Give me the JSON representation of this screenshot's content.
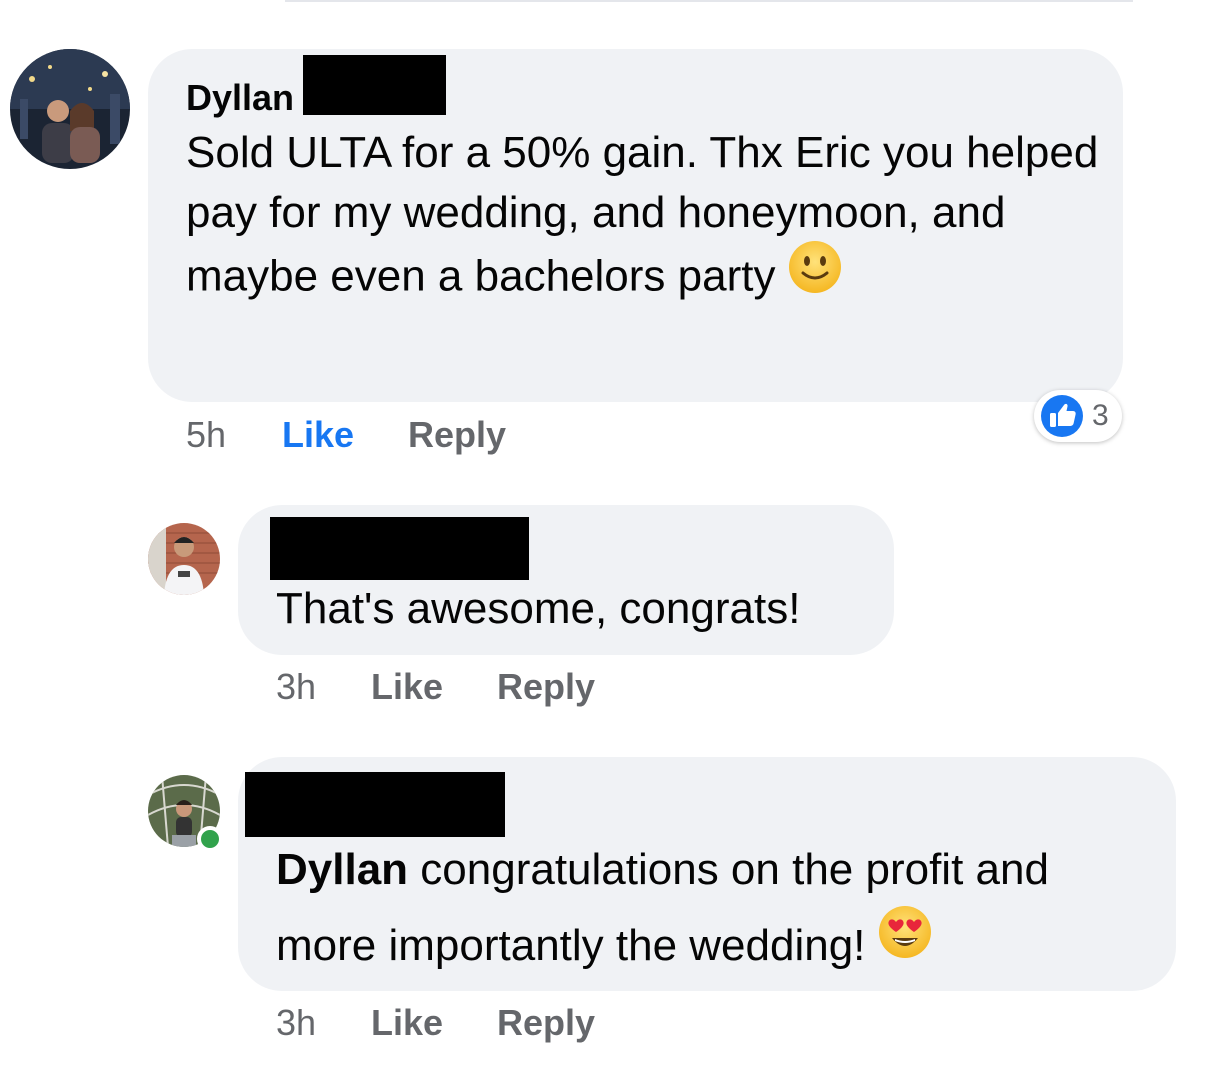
{
  "comments": [
    {
      "author": "Dyllan",
      "text": "Sold ULTA for a 50% gain. Thx Eric you helped pay for my wedding, and honeymoon, and maybe even a bachelors party",
      "emoji_icon": "slightly-smiling-face-icon",
      "time": "5h",
      "like_label": "Like",
      "reply_label": "Reply",
      "liked": true,
      "reaction": {
        "icon": "thumbs-up-icon",
        "count": "3",
        "color": "#1877f2"
      }
    },
    {
      "author": "",
      "text": "That's awesome, congrats!",
      "time": "3h",
      "like_label": "Like",
      "reply_label": "Reply",
      "liked": false
    },
    {
      "author": "",
      "mention": "Dyllan",
      "text": "congratulations on the profit and more importantly the wedding!",
      "emoji_icon": "heart-eyes-face-icon",
      "time": "3h",
      "like_label": "Like",
      "reply_label": "Reply",
      "liked": false,
      "online": true
    }
  ],
  "colors": {
    "bubble": "#f0f2f5",
    "meta_text": "#65676b",
    "like_active": "#1877f2",
    "online": "#31a24c"
  }
}
